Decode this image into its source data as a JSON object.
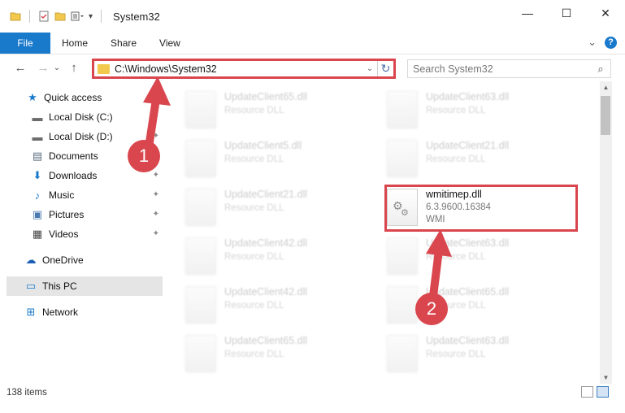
{
  "window": {
    "title": "System32",
    "minimize": "—",
    "maximize": "☐",
    "close": "✕"
  },
  "ribbon": {
    "file": "File",
    "tabs": [
      "Home",
      "Share",
      "View"
    ],
    "expand_icon": "⌄",
    "help": "?"
  },
  "nav": {
    "back": "←",
    "forward": "→",
    "recent": "⌄",
    "up": "↑"
  },
  "address": {
    "path": "C:\\Windows\\System32",
    "dropdown": "⌄",
    "refresh": "↻"
  },
  "search": {
    "placeholder": "Search System32",
    "icon": "⌕"
  },
  "sidebar": {
    "items": [
      {
        "label": "Quick access",
        "icon": "star-icon",
        "glyph": "★",
        "color": "#1979ca"
      },
      {
        "label": "Local Disk (C:)",
        "icon": "drive-icon",
        "glyph": "▬",
        "color": "#6b6b6b",
        "pinned": true
      },
      {
        "label": "Local Disk (D:)",
        "icon": "drive-icon",
        "glyph": "▬",
        "color": "#6b6b6b",
        "pinned": true
      },
      {
        "label": "Documents",
        "icon": "document-icon",
        "glyph": "▤",
        "color": "#5a6c80",
        "pinned": true
      },
      {
        "label": "Downloads",
        "icon": "download-icon",
        "glyph": "⬇",
        "color": "#1979ca",
        "pinned": true
      },
      {
        "label": "Music",
        "icon": "music-icon",
        "glyph": "♪",
        "color": "#1979ca",
        "pinned": true
      },
      {
        "label": "Pictures",
        "icon": "pictures-icon",
        "glyph": "▣",
        "color": "#4a7ab0",
        "pinned": true
      },
      {
        "label": "Videos",
        "icon": "video-icon",
        "glyph": "▦",
        "color": "#444",
        "pinned": true
      },
      {
        "label": "OneDrive",
        "icon": "cloud-icon",
        "glyph": "☁",
        "color": "#1a5fb4"
      },
      {
        "label": "This PC",
        "icon": "computer-icon",
        "glyph": "▭",
        "color": "#1979ca",
        "selected": true
      },
      {
        "label": "Network",
        "icon": "network-icon",
        "glyph": "⊞",
        "color": "#1979ca"
      }
    ],
    "pin_glyph": "📌"
  },
  "files": {
    "col1": [
      {
        "name": "UpdateClient65.dll",
        "type": "Resource DLL"
      },
      {
        "name": "UpdateClient5.dll",
        "type": "Resource DLL"
      },
      {
        "name": "UpdateClient21.dll",
        "type": "Resource DLL"
      },
      {
        "name": "UpdateClient42.dll",
        "type": "Resource DLL"
      },
      {
        "name": "UpdateClient42.dll",
        "type": "Resource DLL"
      },
      {
        "name": "UpdateClient65.dll",
        "type": "Resource DLL"
      }
    ],
    "col2": [
      {
        "name": "UpdateClient63.dll",
        "type": "Resource DLL"
      },
      {
        "name": "UpdateClient21.dll",
        "type": "Resource DLL"
      },
      {
        "name": "wmitimep.dll",
        "version": "6.3.9600.16384",
        "desc": "WMI",
        "highlighted": true
      },
      {
        "name": "UpdateClient63.dll",
        "type": "Resource DLL"
      },
      {
        "name": "UpdateClient65.dll",
        "type": "Resource DLL"
      },
      {
        "name": "UpdateClient63.dll",
        "type": "Resource DLL"
      }
    ]
  },
  "annotations": {
    "step1": "1",
    "step2": "2",
    "color": "#d9464e"
  },
  "status": {
    "count": "138 items"
  }
}
